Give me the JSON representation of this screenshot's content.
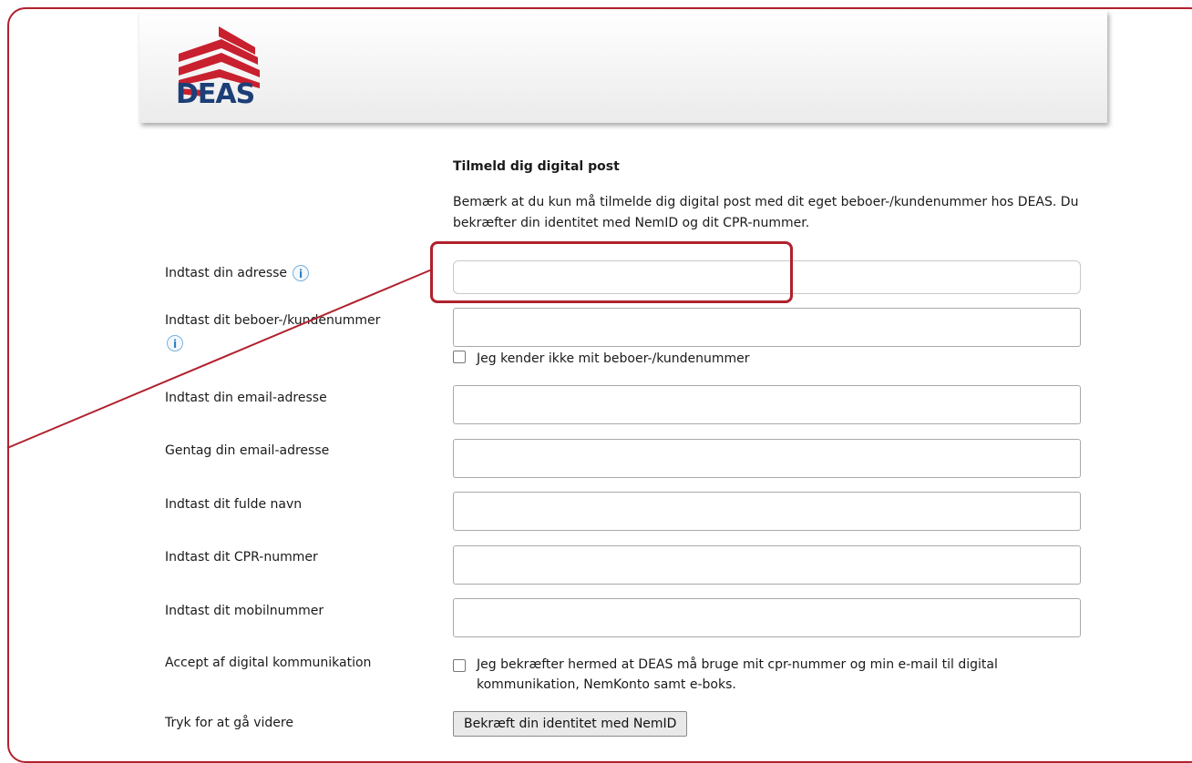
{
  "brand": {
    "logo_text": "DEAS"
  },
  "form": {
    "title": "Tilmeld dig digital post",
    "intro": "Bemærk at du kun må tilmelde dig digital post med dit eget beboer-/kundenummer hos DEAS. Du bekræfter din identitet med NemID og dit CPR-nummer.",
    "fields": {
      "address_label": "Indtast din adresse",
      "customer_label": "Indtast dit beboer-/kundenummer",
      "unknown_customer_checkbox": "Jeg kender ikke mit beboer-/kundenummer",
      "email_label": "Indtast din email-adresse",
      "email_repeat_label": "Gentag din email-adresse",
      "name_label": "Indtast dit fulde navn",
      "cpr_label": "Indtast dit CPR-nummer",
      "mobile_label": "Indtast dit mobilnummer",
      "consent_label": "Accept af digital kommunikation",
      "consent_text": "Jeg bekræfter hermed at DEAS må bruge mit cpr-nummer og min e-mail til digital kommunikation, NemKonto samt e-boks.",
      "continue_label": "Tryk for at gå videre",
      "submit_button": "Bekræft din identitet med NemID"
    },
    "info_icon_glyph": "i"
  },
  "colors": {
    "brand_red": "#c8202f",
    "brand_blue": "#1d3f77",
    "annotation_red": "#b0212d"
  }
}
